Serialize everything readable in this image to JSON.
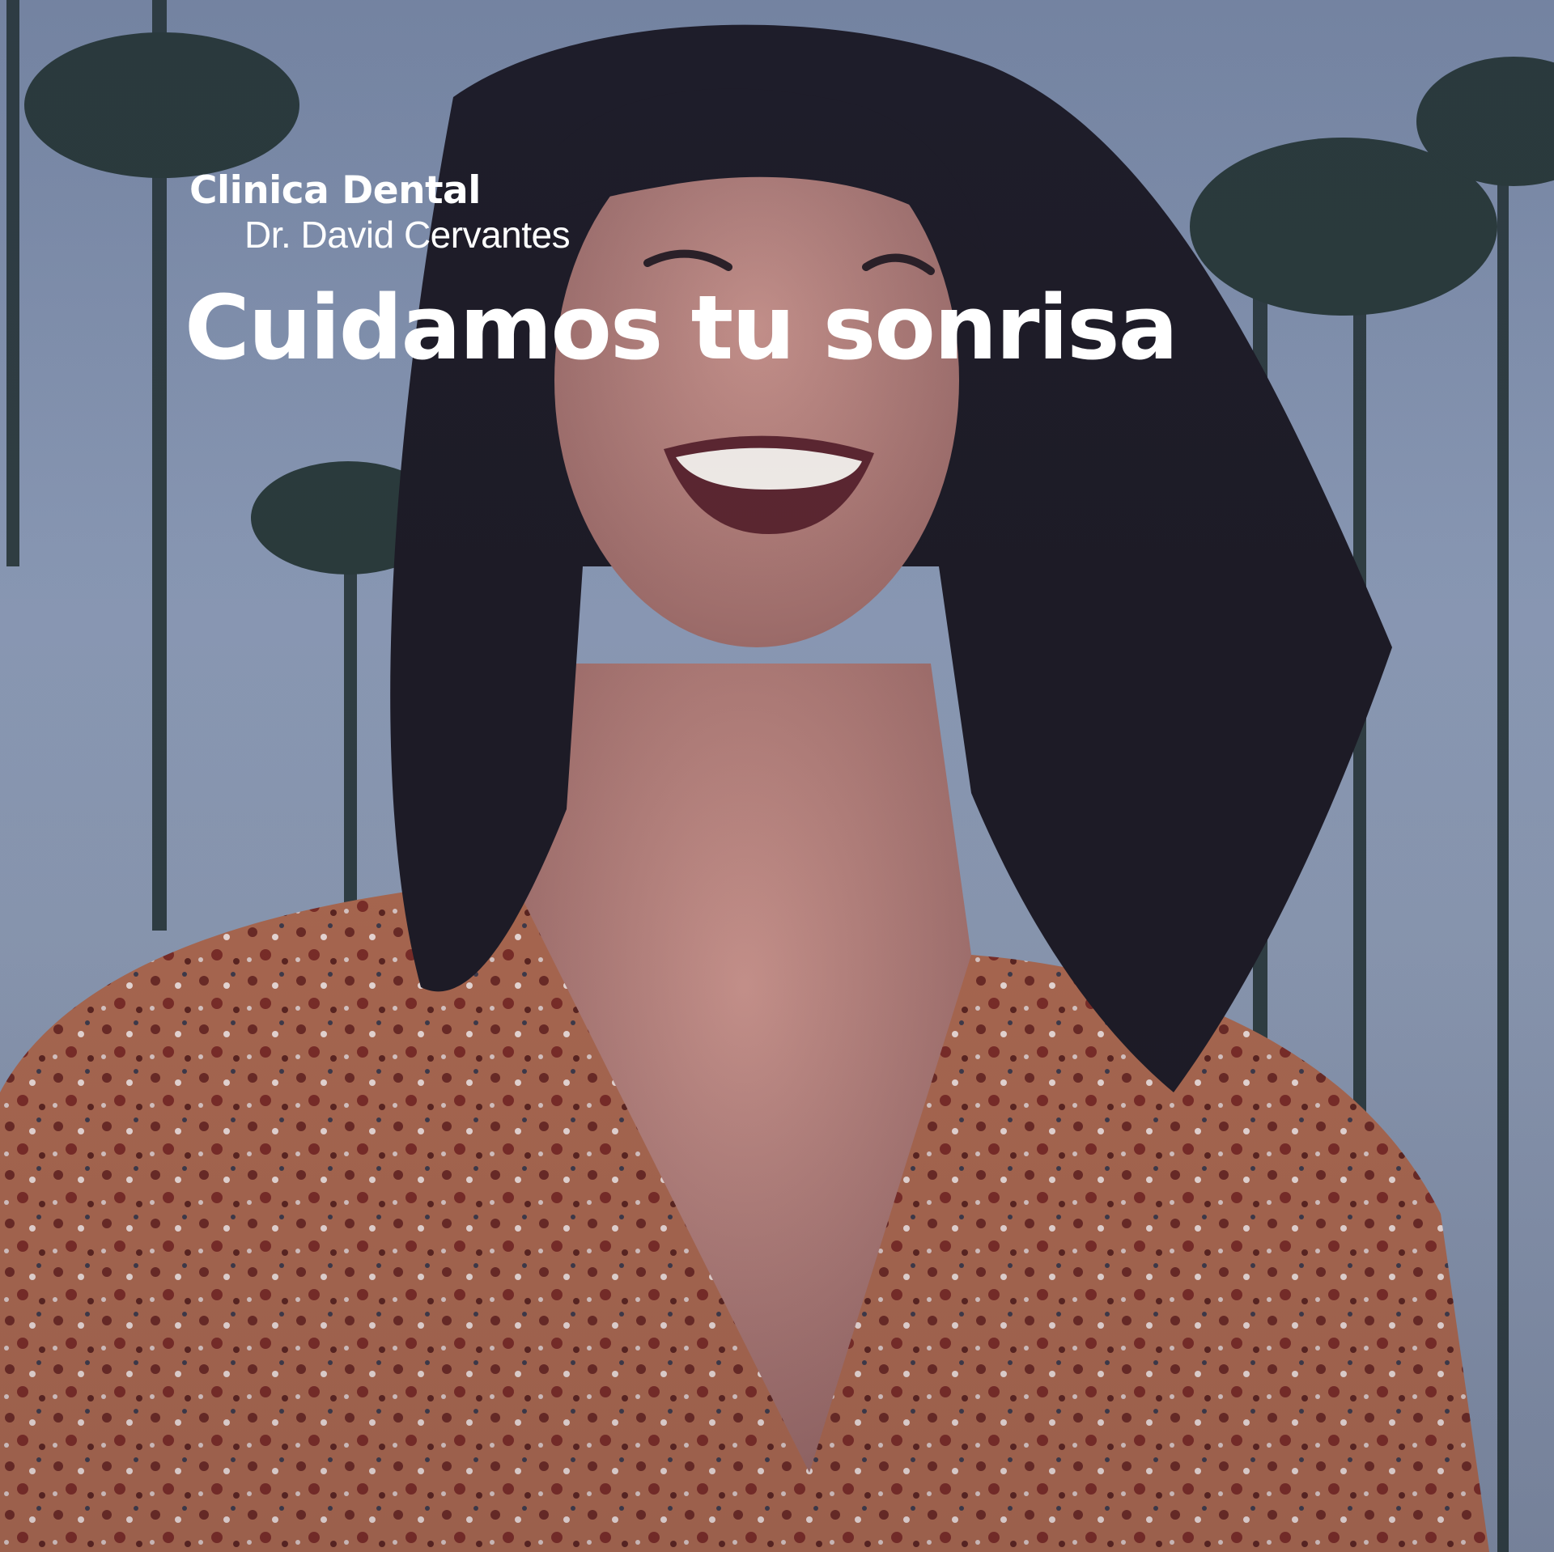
{
  "brand": {
    "name": "Clinica Dental",
    "doctor": "Dr. David Cervantes"
  },
  "hero": {
    "headline": "Cuidamos tu sonrisa"
  },
  "colors": {
    "text": "#ffffff",
    "sky": "#8796b2",
    "blouse": "#a8664d",
    "hair": "#1c1a26"
  }
}
